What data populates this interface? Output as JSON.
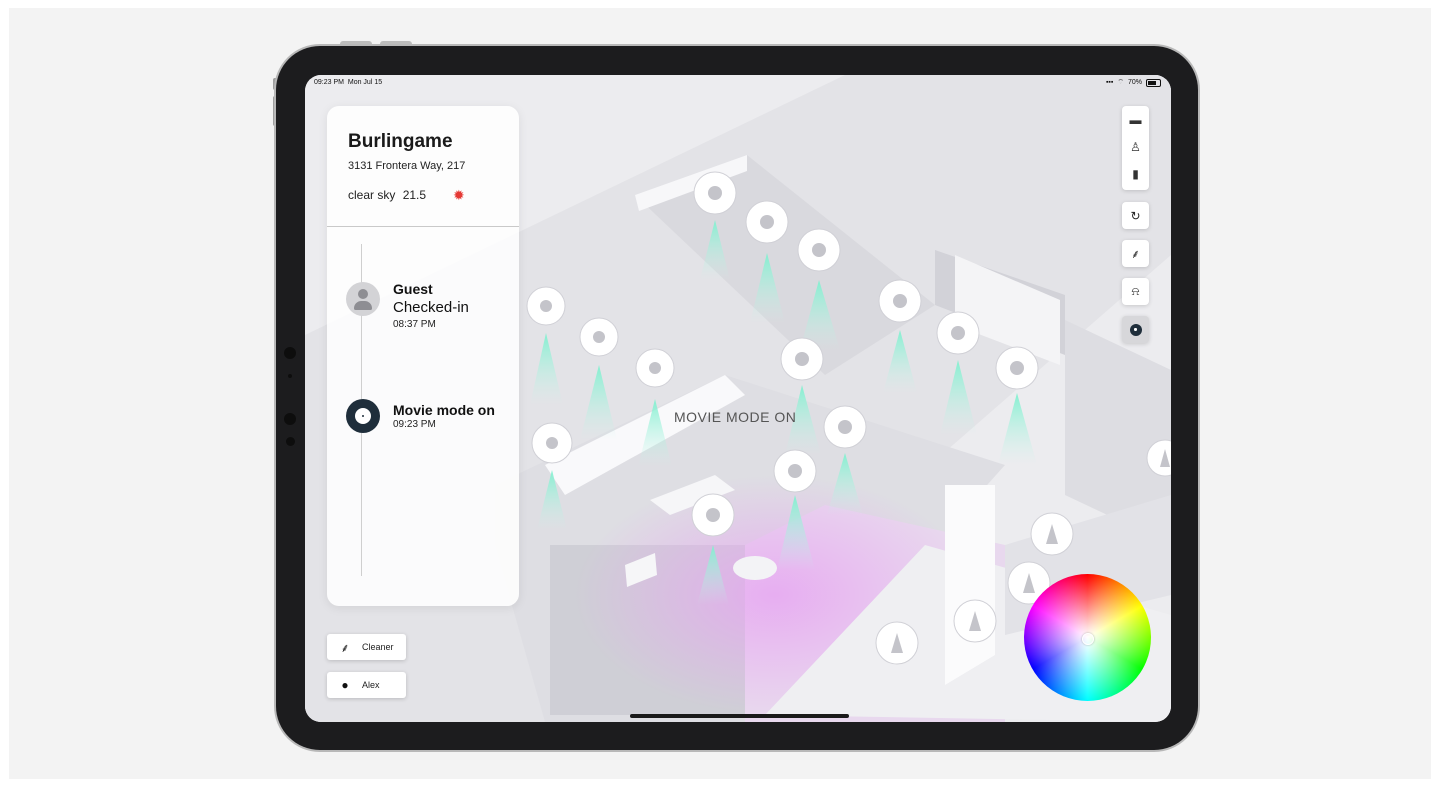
{
  "status_bar": {
    "time": "09:23 PM",
    "date": "Mon Jul 15",
    "battery": "70%"
  },
  "location": {
    "name": "Burlingame",
    "address": "3131 Frontera Way, 217",
    "weather": "clear sky",
    "temperature": "21.5"
  },
  "timeline": [
    {
      "title": "Guest",
      "subtitle": "Checked-in",
      "time": "08:37 PM"
    },
    {
      "title": "Movie mode on",
      "time": "09:23 PM"
    }
  ],
  "scene": {
    "mode_label": "MOVIE MODE ON"
  },
  "people": [
    {
      "label": "Cleaner",
      "icon": "broom-icon"
    },
    {
      "label": "Alex",
      "icon": "person-icon"
    }
  ],
  "toolbar": [
    "air-conditioner-icon",
    "light-bulb-icon",
    "door-icon",
    "refresh-icon",
    "broom-icon",
    "service-bell-icon",
    "film-reel-icon"
  ],
  "colors": {
    "panel": "#ffffff",
    "accent_dark": "#1f2e3b",
    "light_beam": "#8ff0d2"
  }
}
